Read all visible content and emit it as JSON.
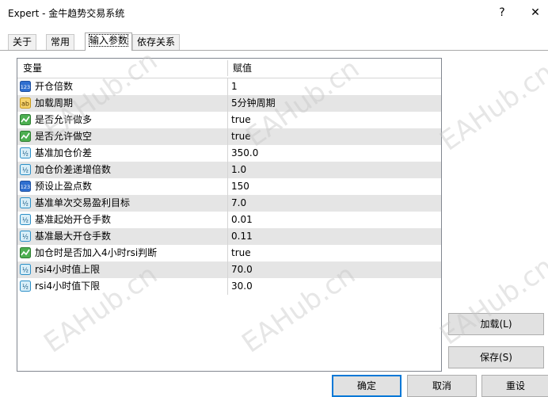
{
  "window": {
    "title": "Expert - 金牛趋势交易系统",
    "help_label": "?",
    "close_label": "✕"
  },
  "tabs": [
    {
      "label": "关于"
    },
    {
      "label": "常用"
    },
    {
      "label": "输入参数"
    },
    {
      "label": "依存关系"
    }
  ],
  "grid": {
    "col_variable": "变量",
    "col_value": "赋值",
    "rows": [
      {
        "icon": "integer-icon",
        "name": "开仓倍数",
        "value": "1"
      },
      {
        "icon": "string-icon",
        "name": "加载周期",
        "value": "5分钟周期"
      },
      {
        "icon": "bool-icon",
        "name": "是否允许做多",
        "value": "true"
      },
      {
        "icon": "bool-icon",
        "name": "是否允许做空",
        "value": "true"
      },
      {
        "icon": "double-icon",
        "name": "基准加仓价差",
        "value": "350.0"
      },
      {
        "icon": "double-icon",
        "name": "加仓价差递增倍数",
        "value": "1.0"
      },
      {
        "icon": "integer-icon",
        "name": "预设止盈点数",
        "value": "150"
      },
      {
        "icon": "double-icon",
        "name": "基准单次交易盈利目标",
        "value": "7.0"
      },
      {
        "icon": "double-icon",
        "name": "基准起始开仓手数",
        "value": "0.01"
      },
      {
        "icon": "double-icon",
        "name": "基准最大开仓手数",
        "value": "0.11"
      },
      {
        "icon": "bool-icon",
        "name": "加仓时是否加入4小时rsi判断",
        "value": "true"
      },
      {
        "icon": "double-icon",
        "name": "rsi4小时值上限",
        "value": "70.0"
      },
      {
        "icon": "double-icon",
        "name": "rsi4小时值下限",
        "value": "30.0"
      }
    ]
  },
  "buttons": {
    "load": "加载(L)",
    "save": "保存(S)",
    "ok": "确定",
    "cancel": "取消",
    "reset": "重设"
  },
  "icon_text": {
    "integer": "123",
    "string": "ab",
    "double": "½"
  },
  "watermark": "EAHub.cn"
}
